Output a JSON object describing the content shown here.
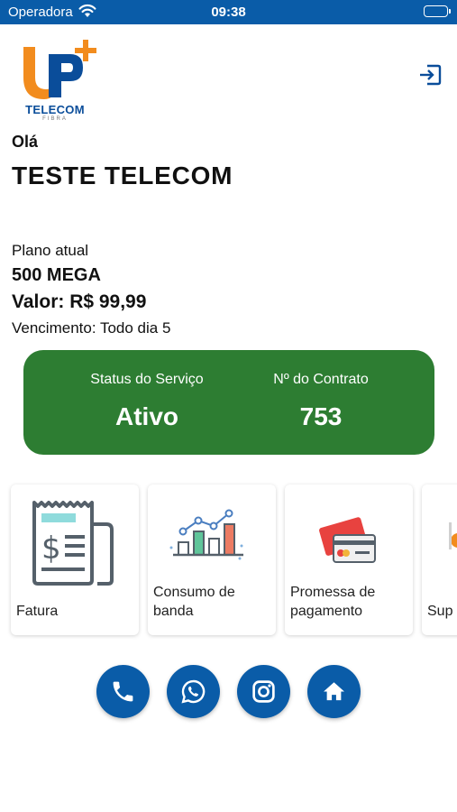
{
  "status_bar": {
    "carrier": "Operadora",
    "time": "09:38",
    "icons": [
      "wifi-icon",
      "battery-icon"
    ]
  },
  "logo": {
    "brand": "TELECOM",
    "tagline": "FIBRA",
    "colors": {
      "orange": "#f28c1e",
      "blue": "#0a4d9a"
    }
  },
  "header": {
    "logout_icon": "logout-icon"
  },
  "greeting": "Olá",
  "user": {
    "name": "TESTE TELECOM"
  },
  "plan": {
    "label": "Plano atual",
    "name": "500 MEGA",
    "value": "Valor: R$ 99,99",
    "due": "Vencimento: Todo dia 5"
  },
  "service_card": {
    "status_label": "Status do Serviço",
    "status_value": "Ativo",
    "contract_label": "Nº do Contrato",
    "contract_value": "753",
    "color": "#2d7d32"
  },
  "menu": [
    {
      "label": "Fatura",
      "icon": "invoice-icon"
    },
    {
      "label": "Consumo de banda",
      "icon": "bandwidth-chart-icon"
    },
    {
      "label": "Promessa de pagamento",
      "icon": "payment-cards-icon"
    },
    {
      "label": "Sup",
      "icon": "support-icon"
    }
  ],
  "actions": [
    {
      "name": "phone",
      "icon": "phone-icon"
    },
    {
      "name": "whatsapp",
      "icon": "whatsapp-icon"
    },
    {
      "name": "instagram",
      "icon": "instagram-icon"
    },
    {
      "name": "home",
      "icon": "home-icon"
    }
  ],
  "theme": {
    "primary": "#0a5ca8",
    "success": "#2d7d32"
  }
}
